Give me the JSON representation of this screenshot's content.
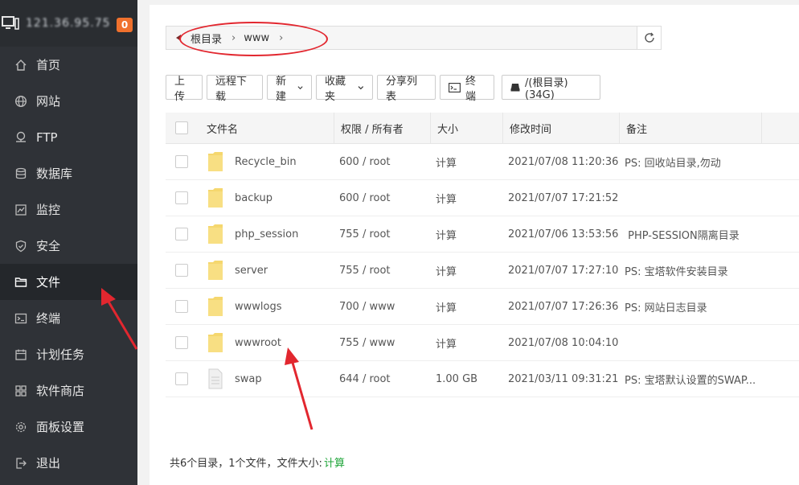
{
  "sidebar": {
    "hostname": "121.36.95.75",
    "badge": "0",
    "items": [
      {
        "label": "首页",
        "icon": "home-icon"
      },
      {
        "label": "网站",
        "icon": "globe-icon"
      },
      {
        "label": "FTP",
        "icon": "ftp-icon"
      },
      {
        "label": "数据库",
        "icon": "database-icon"
      },
      {
        "label": "监控",
        "icon": "monitor-chart-icon"
      },
      {
        "label": "安全",
        "icon": "shield-icon"
      },
      {
        "label": "文件",
        "icon": "folder-icon",
        "active": true
      },
      {
        "label": "终端",
        "icon": "terminal-icon"
      },
      {
        "label": "计划任务",
        "icon": "calendar-icon"
      },
      {
        "label": "软件商店",
        "icon": "grid-icon"
      },
      {
        "label": "面板设置",
        "icon": "gear-icon"
      },
      {
        "label": "退出",
        "icon": "logout-icon"
      }
    ]
  },
  "path": {
    "root": "根目录",
    "current": "www"
  },
  "toolbar": {
    "upload": "上传",
    "remote_download": "远程下载",
    "new": "新建",
    "favorites": "收藏夹",
    "share_list": "分享列表",
    "terminal": "终端",
    "disk": "/(根目录) (34G)"
  },
  "table": {
    "headers": {
      "name": "文件名",
      "perm": "权限 / 所有者",
      "size": "大小",
      "mtime": "修改时间",
      "note": "备注"
    },
    "rows": [
      {
        "name": "Recycle_bin",
        "type": "folder",
        "perm": "600 / root",
        "size": "计算",
        "mtime": "2021/07/08 11:20:36",
        "note": "PS: 回收站目录,勿动"
      },
      {
        "name": "backup",
        "type": "folder",
        "perm": "600 / root",
        "size": "计算",
        "mtime": "2021/07/07 17:21:52",
        "note": ""
      },
      {
        "name": "php_session",
        "type": "folder",
        "perm": "755 / root",
        "size": "计算",
        "mtime": "2021/07/06 13:53:56",
        "note": " PHP-SESSION隔离目录"
      },
      {
        "name": "server",
        "type": "folder",
        "perm": "755 / root",
        "size": "计算",
        "mtime": "2021/07/07 17:27:10",
        "note": "PS: 宝塔软件安装目录"
      },
      {
        "name": "wwwlogs",
        "type": "folder",
        "perm": "700 / www",
        "size": "计算",
        "mtime": "2021/07/07 17:26:36",
        "note": "PS: 网站日志目录"
      },
      {
        "name": "wwwroot",
        "type": "folder",
        "perm": "755 / www",
        "size": "计算",
        "mtime": "2021/07/08 10:04:10",
        "note": ""
      },
      {
        "name": "swap",
        "type": "file",
        "perm": "644 / root",
        "size": "1.00 GB",
        "mtime": "2021/03/11 09:31:21",
        "note": "PS: 宝塔默认设置的SWAP..."
      }
    ]
  },
  "footer": {
    "summary": "共6个目录，1个文件，文件大小:",
    "calc": "计算"
  },
  "colors": {
    "sidebar_bg": "#2f3237",
    "accent_green": "#20a53a",
    "badge_orange": "#f0712d",
    "annotation_red": "#e2272f"
  }
}
